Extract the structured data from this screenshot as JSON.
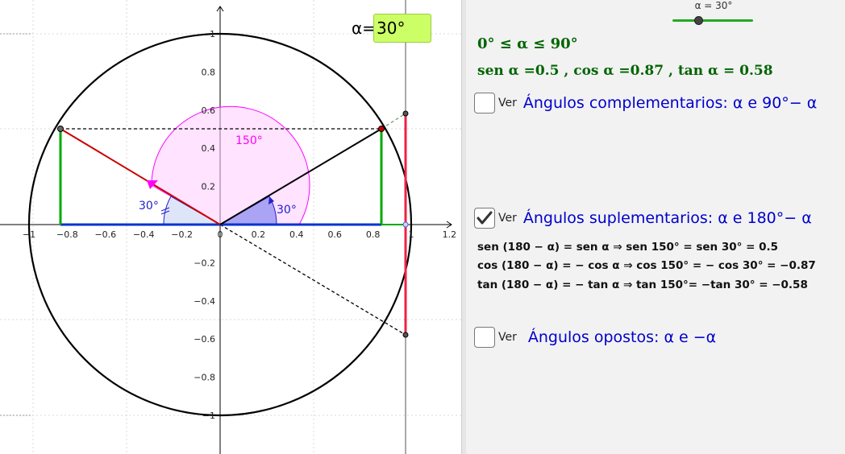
{
  "alpha": {
    "label": "α=",
    "value": "30°"
  },
  "graph": {
    "x_ticks": [
      "−1",
      "−0.8",
      "−0.6",
      "−0.4",
      "−0.2",
      "0",
      "0.2",
      "0.4",
      "0.6",
      "0.8",
      "1",
      "1.2"
    ],
    "y_ticks_pos": [
      "0.8",
      "0.6",
      "0.4",
      "0.2"
    ],
    "y_ticks_neg": [
      "−0.2",
      "−0.4",
      "−0.6",
      "−0.8"
    ],
    "y_edge_ticks": [
      "1",
      "−1"
    ],
    "angle_label_supp": "150°",
    "angle_label_alpha": "30°",
    "angle_label_mirror": "30°",
    "colors": {
      "circle": "#000000",
      "radius_alpha": "#000000",
      "radius_supp": "#cc0000",
      "sine": "#00aa00",
      "cosine": "#0033cc",
      "tangent": "#ee2244",
      "arc_supp": "#ff00ff",
      "arc_alpha": "#2222cc"
    }
  },
  "panel": {
    "slider": {
      "label": "α = 30°",
      "value_deg": 30,
      "min_deg": 0,
      "max_deg": 90
    },
    "range_text": "0° ≤ α ≤ 90°",
    "values_text": "sen α =0.5 , cos α =0.87 , tan α = 0.58",
    "checkboxes": [
      {
        "label": "Ver",
        "title": "Ángulos complementarios: α  e  90°− α",
        "checked": false
      },
      {
        "label": "Ver",
        "title": "Ángulos suplementarios: α e 180°− α",
        "checked": true
      },
      {
        "label": "Ver",
        "title": "Ángulos opostos: α e −α",
        "checked": false
      }
    ],
    "formulas": [
      "sen (180 − α) = sen α ⇒ sen  150° = sen 30° = 0.5",
      "cos (180 − α) = − cos α ⇒ cos  150° = − cos 30° = −0.87",
      "tan (180 − α) = − tan α ⇒ tan 150°= −tan 30° = −0.58"
    ]
  }
}
